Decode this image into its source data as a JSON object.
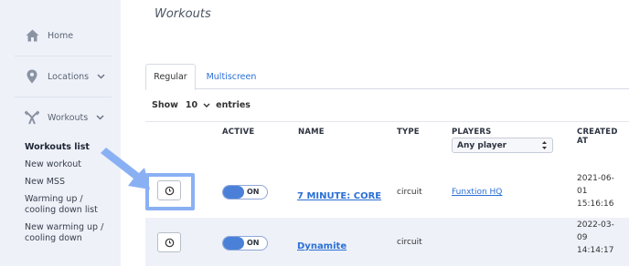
{
  "sidebar": {
    "items": [
      {
        "label": "Home",
        "icon": "home-icon"
      },
      {
        "label": "Locations",
        "icon": "location-pin-icon"
      },
      {
        "label": "Workouts",
        "icon": "dumbbell-icon"
      }
    ],
    "submenu": [
      "Workouts list",
      "New workout",
      "New MSS",
      "Warming up / cooling down list",
      "New warming up / cooling down"
    ]
  },
  "header": {
    "title": "Workouts"
  },
  "tabs": [
    {
      "label": "Regular"
    },
    {
      "label": "Multiscreen"
    }
  ],
  "entries": {
    "prefix": "Show",
    "value": "10",
    "suffix": "entries"
  },
  "table": {
    "columns": {
      "active": "ACTIVE",
      "name": "NAME",
      "type": "TYPE",
      "players": "PLAYERS",
      "created": "CREATED AT"
    },
    "player_filter": "Any player",
    "rows": [
      {
        "active": "ON",
        "name": "7 MINUTE: CORE",
        "type": "circuit",
        "players": "Funxtion HQ",
        "created_a": "2021-06-",
        "created_b": "01",
        "created_c": "15:16:16"
      },
      {
        "active": "ON",
        "name": "Dynamite",
        "type": "circuit",
        "players": "",
        "created_a": "2022-03-",
        "created_b": "09",
        "created_c": "14:14:17"
      }
    ]
  },
  "colors": {
    "accent": "#2a6fd6",
    "highlight": "#8ab0f4",
    "toggle": "#4a80d8",
    "sidebar_bg": "#eef1f8"
  }
}
